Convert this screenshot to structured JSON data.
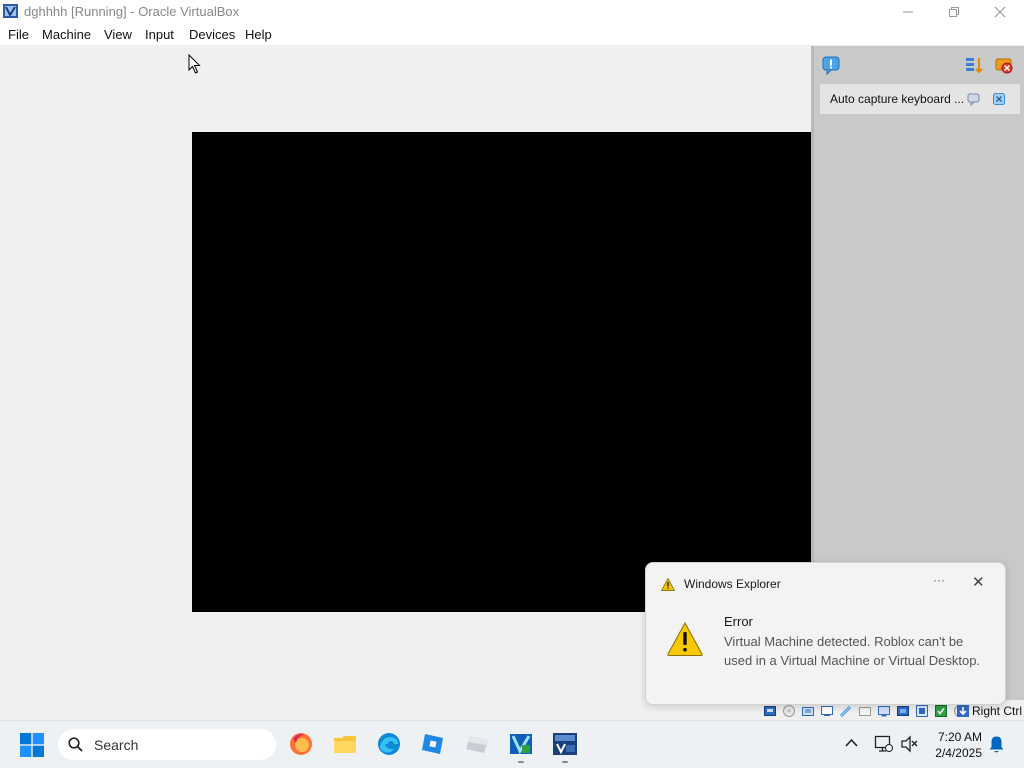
{
  "window": {
    "title": "dghhhh [Running] - Oracle VirtualBox"
  },
  "menu": {
    "items": [
      "File",
      "Machine",
      "View",
      "Input",
      "Devices",
      "Help"
    ]
  },
  "side_panel": {
    "auto_capture_label": "Auto capture keyboard ..."
  },
  "status_bar": {
    "host_key": "Right Ctrl"
  },
  "notification": {
    "app_name": "Windows Explorer",
    "more_label": "···",
    "close_label": "✕",
    "heading": "Error",
    "message": "Virtual Machine detected. Roblox can't be used in a Virtual Machine or Virtual Desktop."
  },
  "taskbar": {
    "search_label": "Search",
    "apps": [
      "firefox-icon",
      "file-explorer-icon",
      "edge-icon",
      "roblox-icon",
      "roblox-studio-icon",
      "virtualbox-icon",
      "visual-studio-2008-icon"
    ],
    "time": "7:20 AM",
    "date": "2/4/2025"
  },
  "colors": {
    "accent": "#0067c0",
    "warning": "#f5c400",
    "vm_screen": "#000000"
  }
}
